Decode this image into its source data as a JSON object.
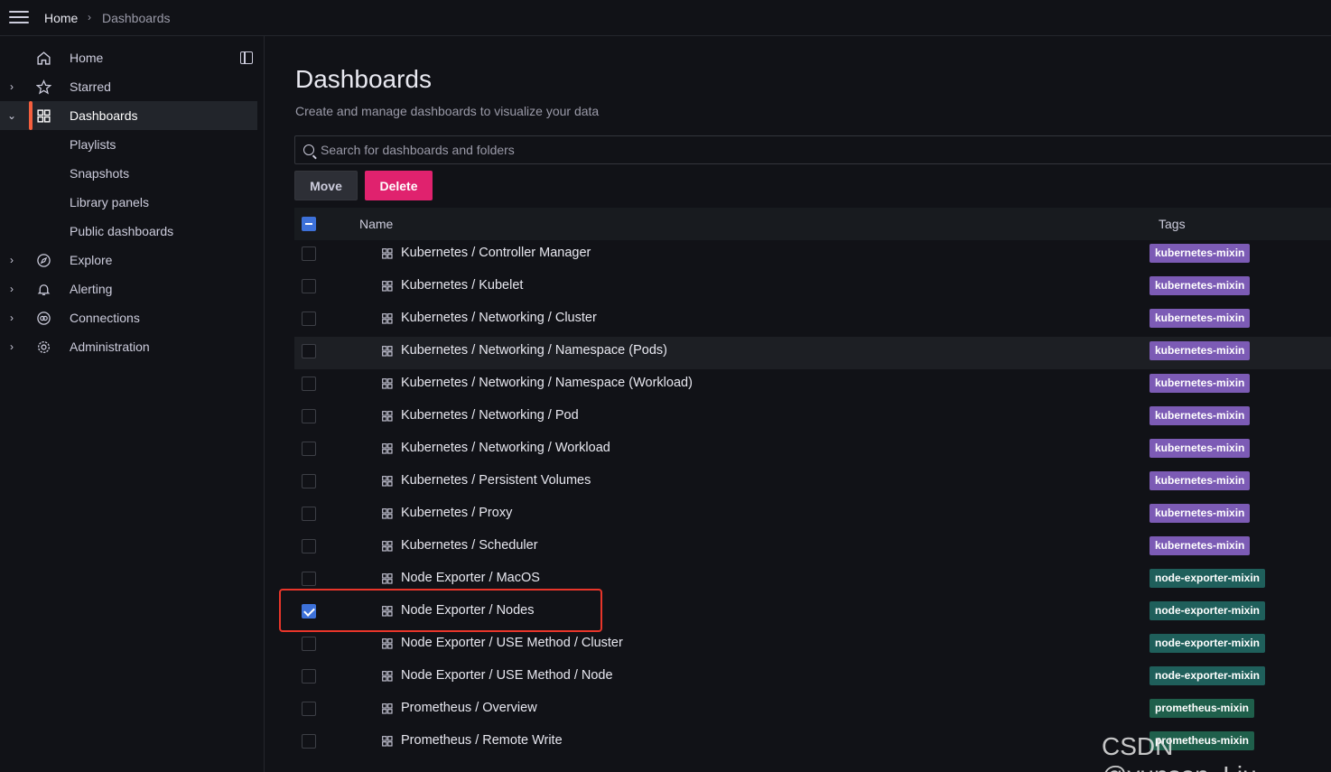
{
  "breadcrumb": {
    "home": "Home",
    "separator": "›",
    "current": "Dashboards"
  },
  "sidebar": {
    "items": [
      {
        "label": "Home",
        "icon": "home-icon",
        "expandable": false,
        "active": false
      },
      {
        "label": "Starred",
        "icon": "star-icon",
        "expandable": true,
        "active": false
      },
      {
        "label": "Dashboards",
        "icon": "grid-icon",
        "expandable": true,
        "expanded": true,
        "active": true
      },
      {
        "label": "Playlists",
        "sub": true
      },
      {
        "label": "Snapshots",
        "sub": true
      },
      {
        "label": "Library panels",
        "sub": true
      },
      {
        "label": "Public dashboards",
        "sub": true
      },
      {
        "label": "Explore",
        "icon": "compass-icon",
        "expandable": true
      },
      {
        "label": "Alerting",
        "icon": "bell-icon",
        "expandable": true
      },
      {
        "label": "Connections",
        "icon": "connections-icon",
        "expandable": true
      },
      {
        "label": "Administration",
        "icon": "cog-icon",
        "expandable": true
      }
    ]
  },
  "page": {
    "title": "Dashboards",
    "subtitle": "Create and manage dashboards to visualize your data"
  },
  "search": {
    "placeholder": "Search for dashboards and folders"
  },
  "actions": {
    "move": "Move",
    "delete": "Delete"
  },
  "table": {
    "headers": {
      "name": "Name",
      "tags": "Tags"
    },
    "rows": [
      {
        "name": "Kubernetes / Controller Manager",
        "tag": "kubernetes-mixin",
        "checked": false
      },
      {
        "name": "Kubernetes / Kubelet",
        "tag": "kubernetes-mixin",
        "checked": false
      },
      {
        "name": "Kubernetes / Networking / Cluster",
        "tag": "kubernetes-mixin",
        "checked": false
      },
      {
        "name": "Kubernetes / Networking / Namespace (Pods)",
        "tag": "kubernetes-mixin",
        "checked": false
      },
      {
        "name": "Kubernetes / Networking / Namespace (Workload)",
        "tag": "kubernetes-mixin",
        "checked": false
      },
      {
        "name": "Kubernetes / Networking / Pod",
        "tag": "kubernetes-mixin",
        "checked": false
      },
      {
        "name": "Kubernetes / Networking / Workload",
        "tag": "kubernetes-mixin",
        "checked": false
      },
      {
        "name": "Kubernetes / Persistent Volumes",
        "tag": "kubernetes-mixin",
        "checked": false
      },
      {
        "name": "Kubernetes / Proxy",
        "tag": "kubernetes-mixin",
        "checked": false
      },
      {
        "name": "Kubernetes / Scheduler",
        "tag": "kubernetes-mixin",
        "checked": false
      },
      {
        "name": "Node Exporter / MacOS",
        "tag": "node-exporter-mixin",
        "checked": false
      },
      {
        "name": "Node Exporter / Nodes",
        "tag": "node-exporter-mixin",
        "checked": true
      },
      {
        "name": "Node Exporter / USE Method / Cluster",
        "tag": "node-exporter-mixin",
        "checked": false
      },
      {
        "name": "Node Exporter / USE Method / Node",
        "tag": "node-exporter-mixin",
        "checked": false
      },
      {
        "name": "Prometheus / Overview",
        "tag": "prometheus-mixin",
        "checked": false
      },
      {
        "name": "Prometheus / Remote Write",
        "tag": "prometheus-mixin",
        "checked": false
      }
    ]
  },
  "tag_colors": {
    "kubernetes-mixin": "#7c5bb5",
    "node-exporter-mixin": "#1f5f5b",
    "prometheus-mixin": "#1f5f4b"
  },
  "colors": {
    "accent": "#3d71d9",
    "danger": "#e0226e",
    "active_bar": "#f55f3e",
    "highlight_box": "#e8352a"
  },
  "watermark": "CSDN @yunson_Liu"
}
